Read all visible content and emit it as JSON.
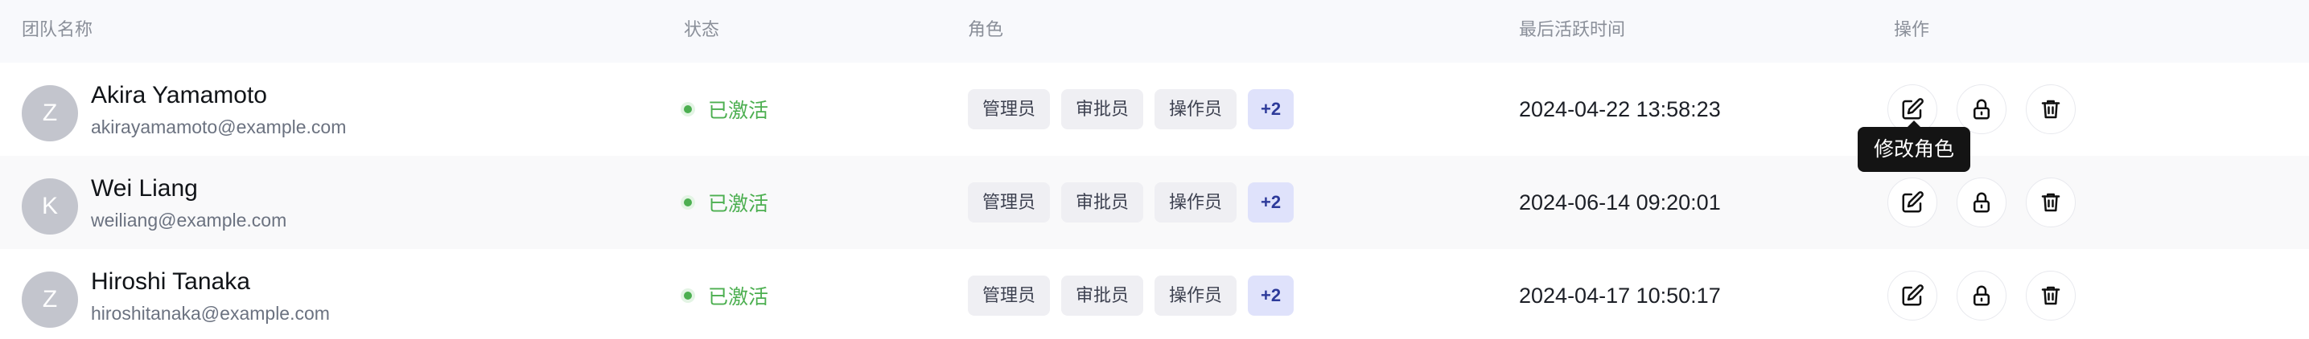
{
  "header": {
    "team_name": "团队名称",
    "status": "状态",
    "role": "角色",
    "last_active": "最后活跃时间",
    "actions": "操作"
  },
  "rows": [
    {
      "avatar": "Z",
      "name": "Akira Yamamoto",
      "email": "akirayamamoto@example.com",
      "status": "已激活",
      "roles": [
        "管理员",
        "审批员",
        "操作员"
      ],
      "more_roles": "+2",
      "last_active": "2024-04-22 13:58:23"
    },
    {
      "avatar": "K",
      "name": "Wei Liang",
      "email": "weiliang@example.com",
      "status": "已激活",
      "roles": [
        "管理员",
        "审批员",
        "操作员"
      ],
      "more_roles": "+2",
      "last_active": "2024-06-14 09:20:01"
    },
    {
      "avatar": "Z",
      "name": "Hiroshi Tanaka",
      "email": "hiroshitanaka@example.com",
      "status": "已激活",
      "roles": [
        "管理员",
        "审批员",
        "操作员"
      ],
      "more_roles": "+2",
      "last_active": "2024-04-17 10:50:17"
    }
  ],
  "action_icons": [
    "edit-icon",
    "lock-icon",
    "trash-icon"
  ],
  "tooltip": {
    "text": "修改角色"
  },
  "colors": {
    "status_active": "#4caf50",
    "more_tag_bg": "#dfe2fb",
    "more_tag_text": "#2d3a9a",
    "tooltip_bg": "#141414",
    "avatar_bg": "#c3c5cd"
  }
}
